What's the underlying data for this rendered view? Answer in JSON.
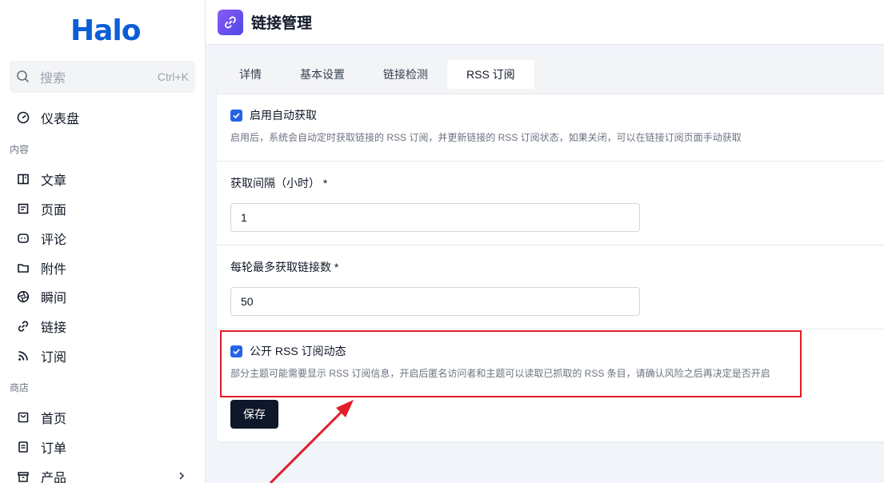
{
  "app": {
    "logo": "Halo"
  },
  "search": {
    "placeholder": "搜索",
    "shortcut": "Ctrl+K"
  },
  "sidebar": {
    "top_item": {
      "label": "仪表盘",
      "icon": "dashboard-icon"
    },
    "groups": [
      {
        "label": "内容"
      },
      {
        "label": "商店"
      }
    ],
    "content_items": [
      {
        "label": "文章",
        "icon": "book-icon"
      },
      {
        "label": "页面",
        "icon": "page-icon"
      },
      {
        "label": "评论",
        "icon": "comment-icon"
      },
      {
        "label": "附件",
        "icon": "folder-icon"
      },
      {
        "label": "瞬间",
        "icon": "aperture-icon"
      },
      {
        "label": "链接",
        "icon": "link-icon"
      },
      {
        "label": "订阅",
        "icon": "rss-icon"
      }
    ],
    "store_items": [
      {
        "label": "首页",
        "icon": "store-home-icon"
      },
      {
        "label": "订单",
        "icon": "order-icon"
      },
      {
        "label": "产品",
        "icon": "archive-icon"
      }
    ]
  },
  "header": {
    "title": "链接管理",
    "icon": "link-icon"
  },
  "tabs": [
    {
      "label": "详情"
    },
    {
      "label": "基本设置"
    },
    {
      "label": "链接检测"
    },
    {
      "label": "RSS 订阅",
      "active": true
    }
  ],
  "form": {
    "auto_fetch": {
      "label": "启用自动获取",
      "checked": true,
      "help": "启用后，系统会自动定时获取链接的 RSS 订阅，并更新链接的 RSS 订阅状态，如果关闭，可以在链接订阅页面手动获取"
    },
    "interval": {
      "label": "获取间隔（小时） *",
      "value": "1"
    },
    "max_links": {
      "label": "每轮最多获取链接数 *",
      "value": "50"
    },
    "public_rss": {
      "label": "公开 RSS 订阅动态",
      "checked": true,
      "help": "部分主题可能需要显示 RSS 订阅信息，开启后匿名访问者和主题可以读取已抓取的 RSS 条目，请确认风险之后再决定是否开启"
    },
    "save_label": "保存"
  },
  "colors": {
    "accent": "#2563eb",
    "highlight": "#e11d2a",
    "logo": "#0b5ed7",
    "button": "#0f172a"
  }
}
